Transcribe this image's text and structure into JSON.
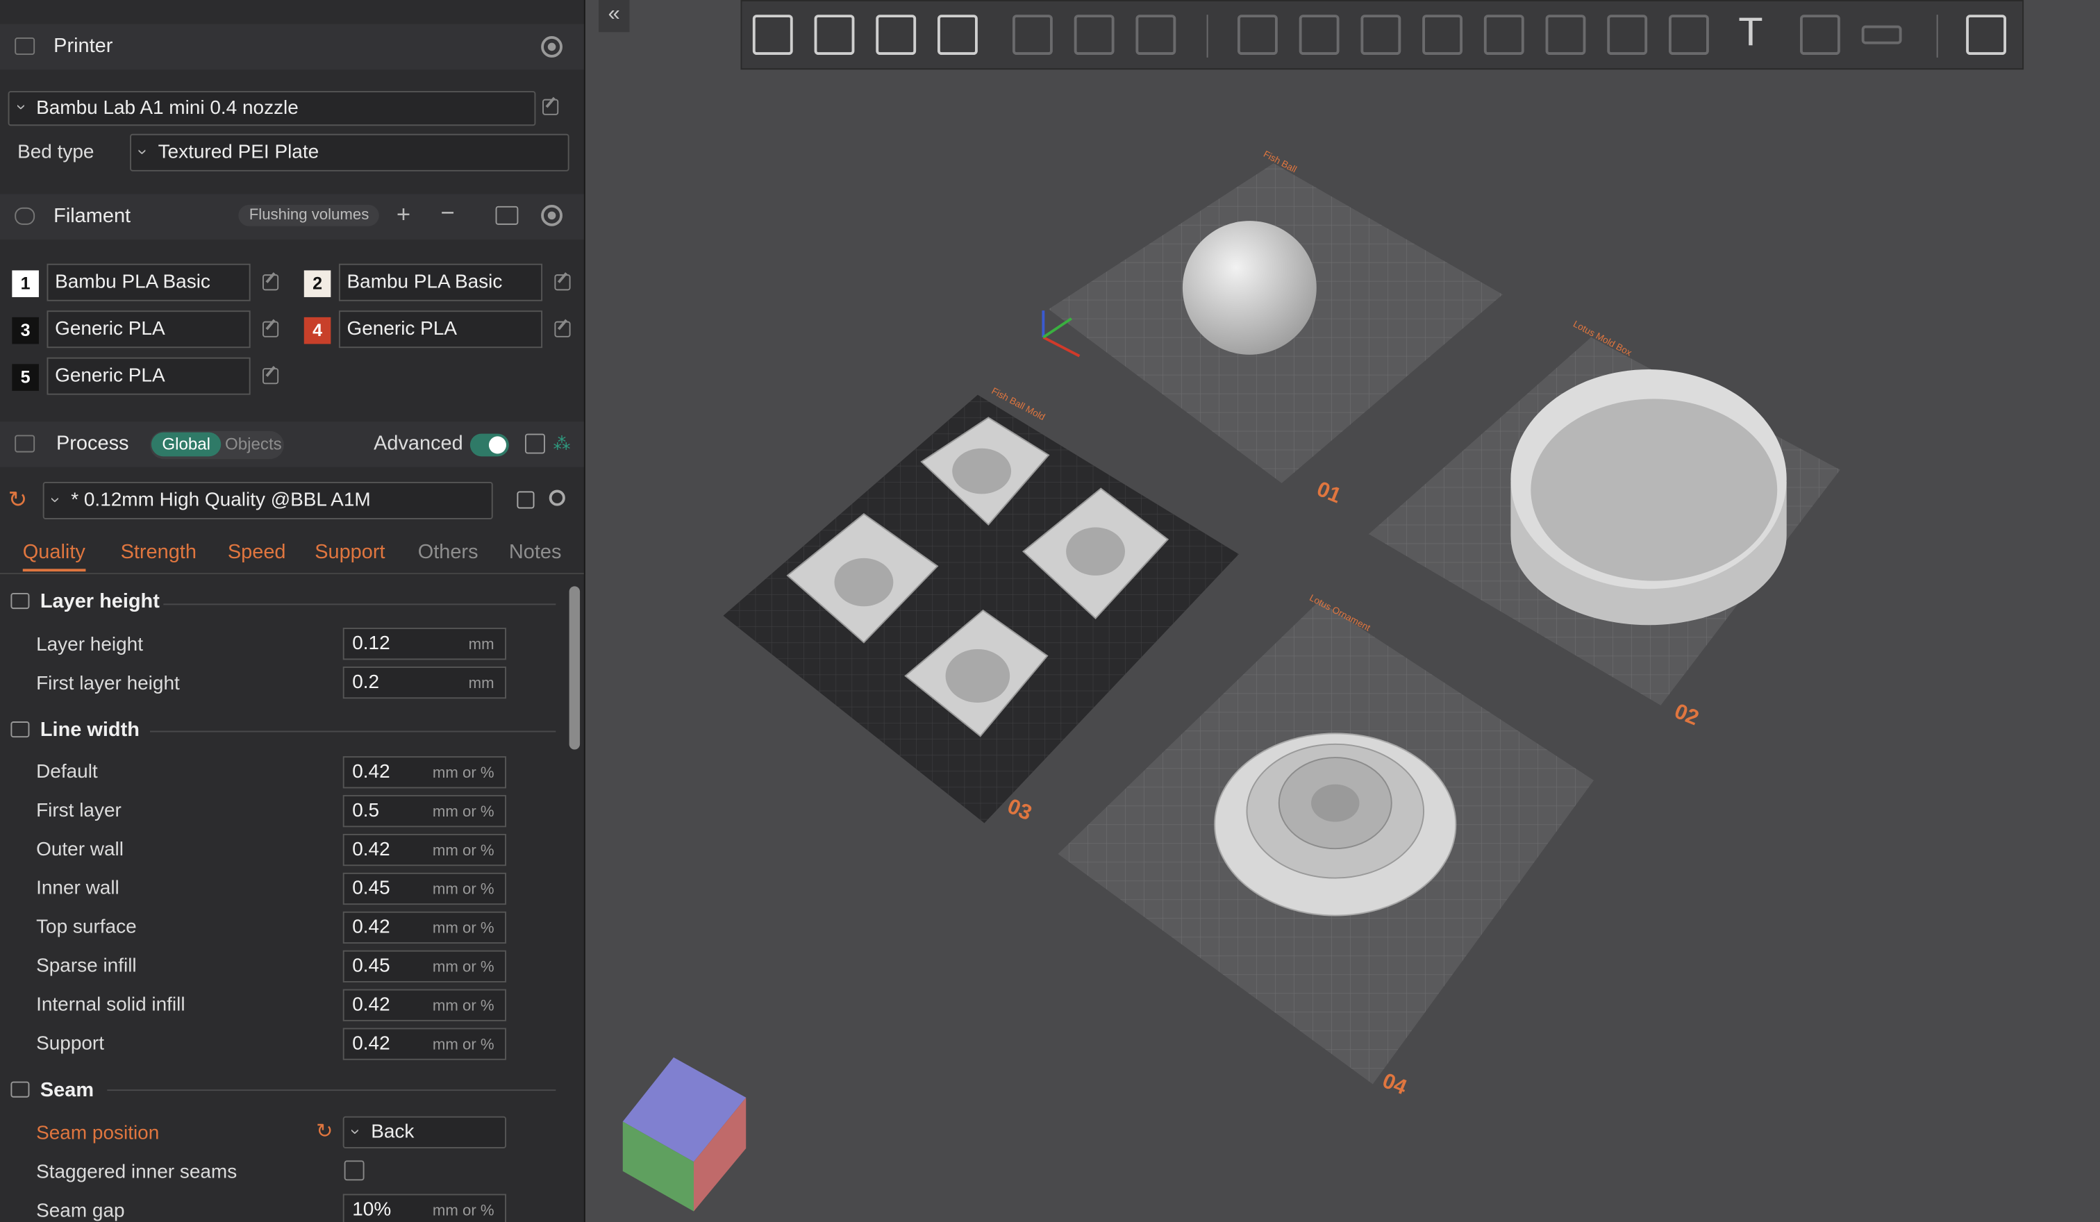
{
  "printer": {
    "title": "Printer",
    "preset": "Bambu Lab A1 mini 0.4 nozzle",
    "bed_type_label": "Bed type",
    "bed_type": "Textured PEI Plate"
  },
  "filament": {
    "title": "Filament",
    "flushing_label": "Flushing volumes",
    "items": [
      {
        "num": "1",
        "name": "Bambu PLA Basic",
        "color": "#ffffff"
      },
      {
        "num": "2",
        "name": "Bambu PLA Basic",
        "color": "#f2ece4"
      },
      {
        "num": "3",
        "name": "Generic PLA",
        "color": "#111111"
      },
      {
        "num": "4",
        "name": "Generic PLA",
        "color": "#c8402a"
      },
      {
        "num": "5",
        "name": "Generic PLA",
        "color": "#111111"
      }
    ]
  },
  "process": {
    "title": "Process",
    "scope_global": "Global",
    "scope_objects": "Objects",
    "advanced_label": "Advanced",
    "advanced_on": true,
    "preset": "* 0.12mm High Quality @BBL A1M",
    "tabs": [
      "Quality",
      "Strength",
      "Speed",
      "Support",
      "Others",
      "Notes"
    ],
    "layer_height": {
      "title": "Layer height",
      "rows": [
        {
          "label": "Layer height",
          "value": "0.12",
          "unit": "mm"
        },
        {
          "label": "First layer height",
          "value": "0.2",
          "unit": "mm"
        }
      ]
    },
    "line_width": {
      "title": "Line width",
      "rows": [
        {
          "label": "Default",
          "value": "0.42",
          "unit": "mm or %"
        },
        {
          "label": "First layer",
          "value": "0.5",
          "unit": "mm or %"
        },
        {
          "label": "Outer wall",
          "value": "0.42",
          "unit": "mm or %"
        },
        {
          "label": "Inner wall",
          "value": "0.45",
          "unit": "mm or %"
        },
        {
          "label": "Top surface",
          "value": "0.42",
          "unit": "mm or %"
        },
        {
          "label": "Sparse infill",
          "value": "0.45",
          "unit": "mm or %"
        },
        {
          "label": "Internal solid infill",
          "value": "0.42",
          "unit": "mm or %"
        },
        {
          "label": "Support",
          "value": "0.42",
          "unit": "mm or %"
        }
      ]
    },
    "seam": {
      "title": "Seam",
      "position_label": "Seam position",
      "position_value": "Back",
      "staggered_label": "Staggered inner seams",
      "gap_label": "Seam gap",
      "gap_value": "10%",
      "gap_unit": "mm or %"
    }
  },
  "plates": [
    {
      "num": "01",
      "name": "Fish Ball"
    },
    {
      "num": "02",
      "name": "Lotus Mold Box"
    },
    {
      "num": "03",
      "name": "Fish Ball Mold"
    },
    {
      "num": "04",
      "name": "Lotus Ornament"
    }
  ],
  "accent": "#e0763f",
  "toggle_color": "#2f7a67"
}
